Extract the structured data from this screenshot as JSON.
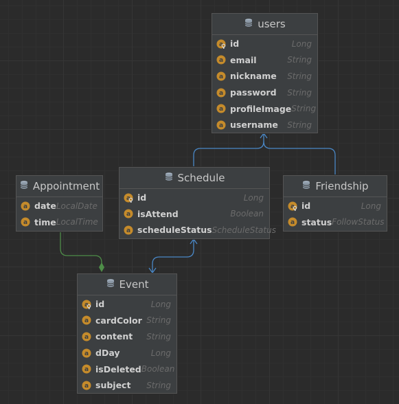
{
  "entities": {
    "users": {
      "name": "users",
      "fields": [
        {
          "name": "id",
          "type": "Long",
          "key": true
        },
        {
          "name": "email",
          "type": "String",
          "key": false
        },
        {
          "name": "nickname",
          "type": "String",
          "key": false
        },
        {
          "name": "password",
          "type": "String",
          "key": false
        },
        {
          "name": "profileImage",
          "type": "String",
          "key": false
        },
        {
          "name": "username",
          "type": "String",
          "key": false
        }
      ]
    },
    "schedule": {
      "name": "Schedule",
      "fields": [
        {
          "name": "id",
          "type": "Long",
          "key": true
        },
        {
          "name": "isAttend",
          "type": "Boolean",
          "key": false
        },
        {
          "name": "scheduleStatus",
          "type": "ScheduleStatus",
          "key": false
        }
      ]
    },
    "appointment": {
      "name": "Appointment",
      "fields": [
        {
          "name": "date",
          "type": "LocalDate",
          "key": false
        },
        {
          "name": "time",
          "type": "LocalTime",
          "key": false
        }
      ]
    },
    "friendship": {
      "name": "Friendship",
      "fields": [
        {
          "name": "id",
          "type": "Long",
          "key": true
        },
        {
          "name": "status",
          "type": "FollowStatus",
          "key": false
        }
      ]
    },
    "event": {
      "name": "Event",
      "fields": [
        {
          "name": "id",
          "type": "Long",
          "key": true
        },
        {
          "name": "cardColor",
          "type": "String",
          "key": false
        },
        {
          "name": "content",
          "type": "String",
          "key": false
        },
        {
          "name": "dDay",
          "type": "Long",
          "key": false
        },
        {
          "name": "isDeleted",
          "type": "Boolean",
          "key": false
        },
        {
          "name": "subject",
          "type": "String",
          "key": false
        }
      ]
    }
  },
  "icons": {
    "table": "table-icon",
    "field": "field-icon",
    "key": "key-icon"
  },
  "colors": {
    "association": "#4a88c7",
    "composition": "#4e8d48",
    "badge": "#c58b2b"
  }
}
